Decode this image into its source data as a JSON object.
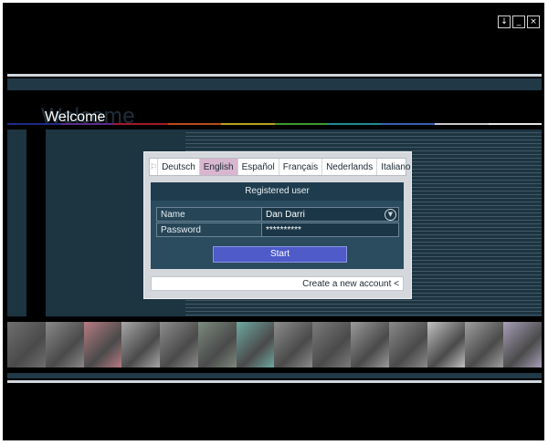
{
  "window_controls": [
    {
      "name": "download-icon",
      "glyph": "↓"
    },
    {
      "name": "minimize-icon",
      "glyph": "_"
    },
    {
      "name": "close-icon",
      "glyph": "×"
    }
  ],
  "header": {
    "welcome": "Welcome",
    "rainbow_colors": [
      "#1f2a88",
      "#5a2d8c",
      "#a11a2a",
      "#b84b1a",
      "#b8a31f",
      "#3e9a2e",
      "#1f8b8d",
      "#3b5fb8",
      "#c9c9c9",
      "#e6e6e6"
    ]
  },
  "languages": {
    "flag_icon": "flag-icon",
    "items": [
      {
        "label": "Deutsch",
        "active": false
      },
      {
        "label": "English",
        "active": true
      },
      {
        "label": "Español",
        "active": false
      },
      {
        "label": "Français",
        "active": false
      },
      {
        "label": "Nederlands",
        "active": false
      },
      {
        "label": "Italiano",
        "active": false
      }
    ]
  },
  "login": {
    "title": "Registered user",
    "name_label": "Name",
    "name_value": "Dan Darri",
    "password_label": "Password",
    "password_value": "**********",
    "start_label": "Start"
  },
  "footer": {
    "create_account": "Create a new account <"
  },
  "photo_strip": [
    "#6f6f6f",
    "#8a8888",
    "#b77b82",
    "#a7a7a7",
    "#8d8d8d",
    "#7c8a7d",
    "#6fa9a1",
    "#8c8c8c",
    "#7b7b7b",
    "#9a9a9a",
    "#8a8a8a",
    "#c2c2c2",
    "#9f9f9f",
    "#a79eb8"
  ],
  "colors": {
    "accent_language": "#d9b6d0",
    "start_button": "#4e5bc8",
    "panel": "#2b4b5e"
  }
}
